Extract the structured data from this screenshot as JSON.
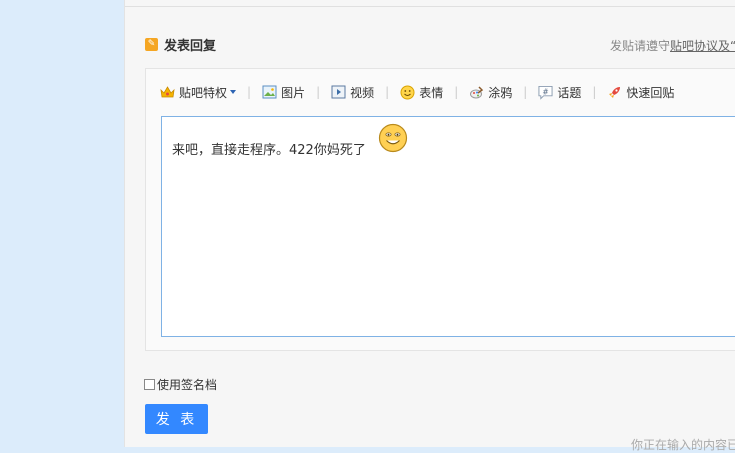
{
  "reply": {
    "title": "发表回复",
    "notice_prefix": "发贴请遵守",
    "notice_link": "贴吧协议及“"
  },
  "toolbar": {
    "items": [
      {
        "label": "贴吧特权",
        "icon": "crown-icon"
      },
      {
        "label": "图片",
        "icon": "image-icon"
      },
      {
        "label": "视频",
        "icon": "video-icon"
      },
      {
        "label": "表情",
        "icon": "smiley-icon"
      },
      {
        "label": "涂鸦",
        "icon": "graffiti-icon"
      },
      {
        "label": "话题",
        "icon": "hashtag-icon"
      },
      {
        "label": "快速回贴",
        "icon": "rocket-icon"
      }
    ],
    "separator": "|"
  },
  "editor": {
    "content": "来吧，直接走程序。422你妈死了"
  },
  "signature": {
    "label": "使用签名档",
    "checked": false
  },
  "publish_label": "发 表",
  "footer_note": "你正在输入的内容已",
  "colors": {
    "page_background": "#dcecfb",
    "accent": "#3388ff",
    "editor_border": "#7fb2e5",
    "toolbar_link": "#2d64b3"
  }
}
